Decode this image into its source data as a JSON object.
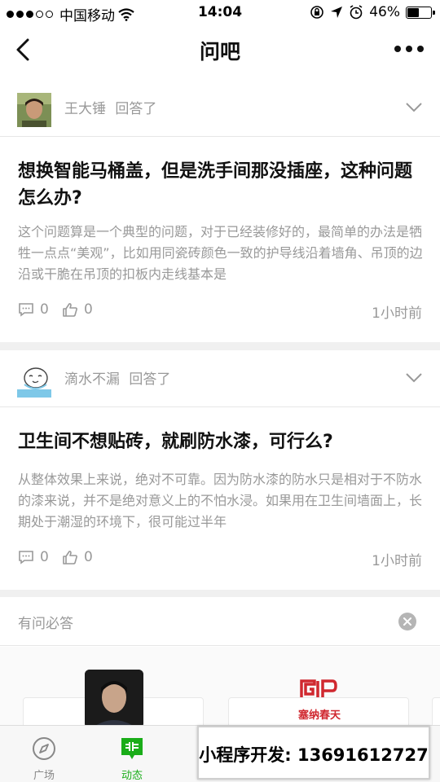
{
  "status_bar": {
    "carrier": "中国移动",
    "time": "14:04",
    "battery_pct": "46%",
    "battery_level": 0.46,
    "icons": [
      "signal-dots-icon",
      "wifi-icon",
      "rotation-lock-icon",
      "location-icon",
      "alarm-icon",
      "battery-icon"
    ]
  },
  "nav": {
    "title": "问吧",
    "back_icon": "chevron-left-icon",
    "more_icon": "more-dots-icon"
  },
  "feed": [
    {
      "user": "王大锤",
      "action": "回答了",
      "question": "想换智能马桶盖，但是洗手间那没插座，这种问题怎么办?",
      "answer": "这个问题算是一个典型的问题，对于已经装修好的，最简单的办法是牺牲一点点“美观”，比如用同瓷砖颜色一致的护导线沿着墙角、吊顶的边沿或干脆在吊顶的扣板内走线基本是",
      "comments": "0",
      "likes": "0",
      "time": "1小时前"
    },
    {
      "user": "滴水不漏",
      "action": "回答了",
      "question": "卫生间不想贴砖，就刷防水漆，可行么?",
      "answer": "从整体效果上来说，绝对不可靠。因为防水漆的防水只是相对于不防水的漆来说，并不是绝对意义上的不怕水浸。如果用在卫生间墙面上，长期处于潮湿的环境下，很可能过半年",
      "comments": "0",
      "likes": "0",
      "time": "1小时前"
    }
  ],
  "section": {
    "title": "有问必答",
    "close_icon": "close-circle-icon",
    "logo_caption": "塞纳春天"
  },
  "tabbar": {
    "tabs": [
      {
        "label": "广场",
        "icon": "compass-icon",
        "active": false
      },
      {
        "label": "动态",
        "icon": "feed-icon",
        "active": true
      }
    ],
    "active_color": "#1aad19"
  },
  "promo": {
    "text": "小程序开发: 13691612727"
  }
}
